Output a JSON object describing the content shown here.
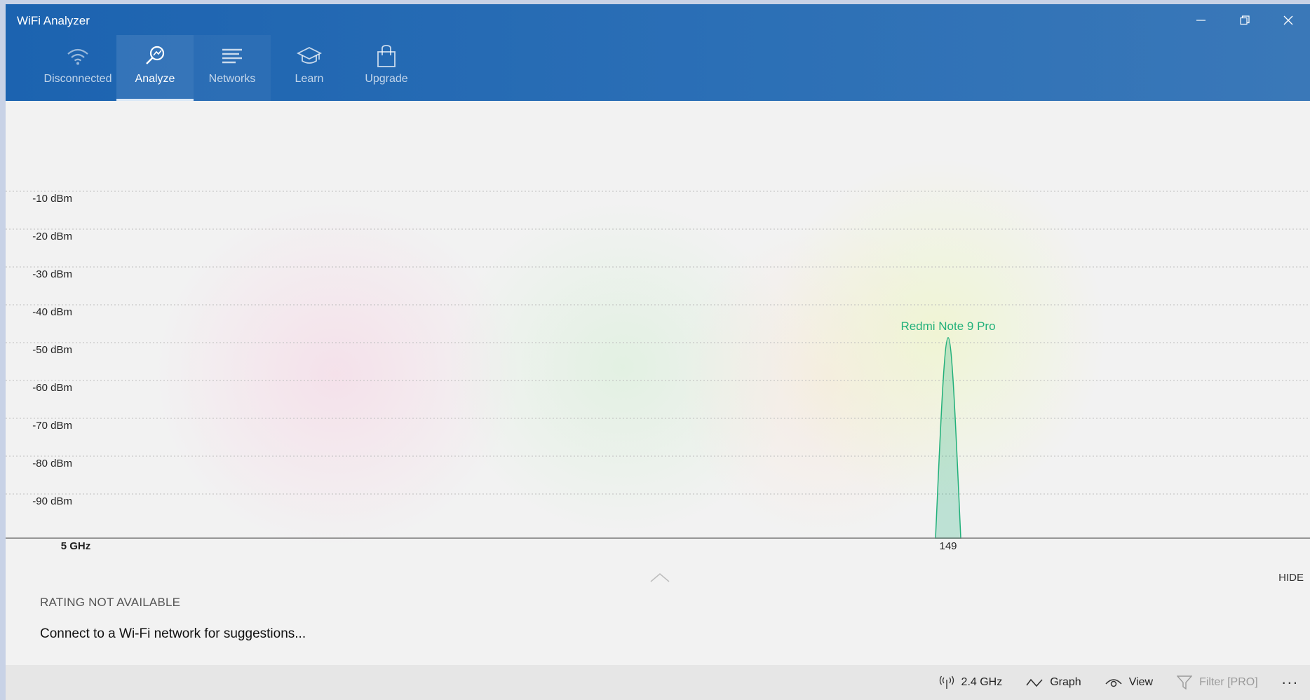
{
  "window": {
    "title": "WiFi Analyzer"
  },
  "nav": [
    {
      "label": "Disconnected",
      "icon": "wifi-icon"
    },
    {
      "label": "Analyze",
      "icon": "analyze-icon",
      "active": true
    },
    {
      "label": "Networks",
      "icon": "networks-icon"
    },
    {
      "label": "Learn",
      "icon": "learn-icon"
    },
    {
      "label": "Upgrade",
      "icon": "upgrade-icon"
    }
  ],
  "chart_data": {
    "type": "area",
    "band_label": "5 GHz",
    "y_ticks": [
      "-10 dBm",
      "-20 dBm",
      "-30 dBm",
      "-40 dBm",
      "-50 dBm",
      "-60 dBm",
      "-70 dBm",
      "-80 dBm",
      "-90 dBm"
    ],
    "y_tick_values": [
      -10,
      -20,
      -30,
      -40,
      -50,
      -60,
      -70,
      -80,
      -90
    ],
    "ylim": [
      -100,
      0
    ],
    "unit": "dBm",
    "x_ticks": [
      "149"
    ],
    "series": [
      {
        "name": "Redmi Note 9 Pro",
        "channel": 149,
        "signal_dbm": -47,
        "color": "#21b07a"
      }
    ],
    "grid": true
  },
  "panel": {
    "hide_label": "HIDE",
    "rating": "RATING NOT AVAILABLE",
    "suggestion": "Connect to a Wi-Fi network for suggestions..."
  },
  "statusbar": {
    "band": "2.4 GHz",
    "graph": "Graph",
    "view": "View",
    "filter": "Filter [PRO]",
    "more": "..."
  },
  "colors": {
    "titlebar": "#1c63b0",
    "accent": "#21b07a"
  }
}
